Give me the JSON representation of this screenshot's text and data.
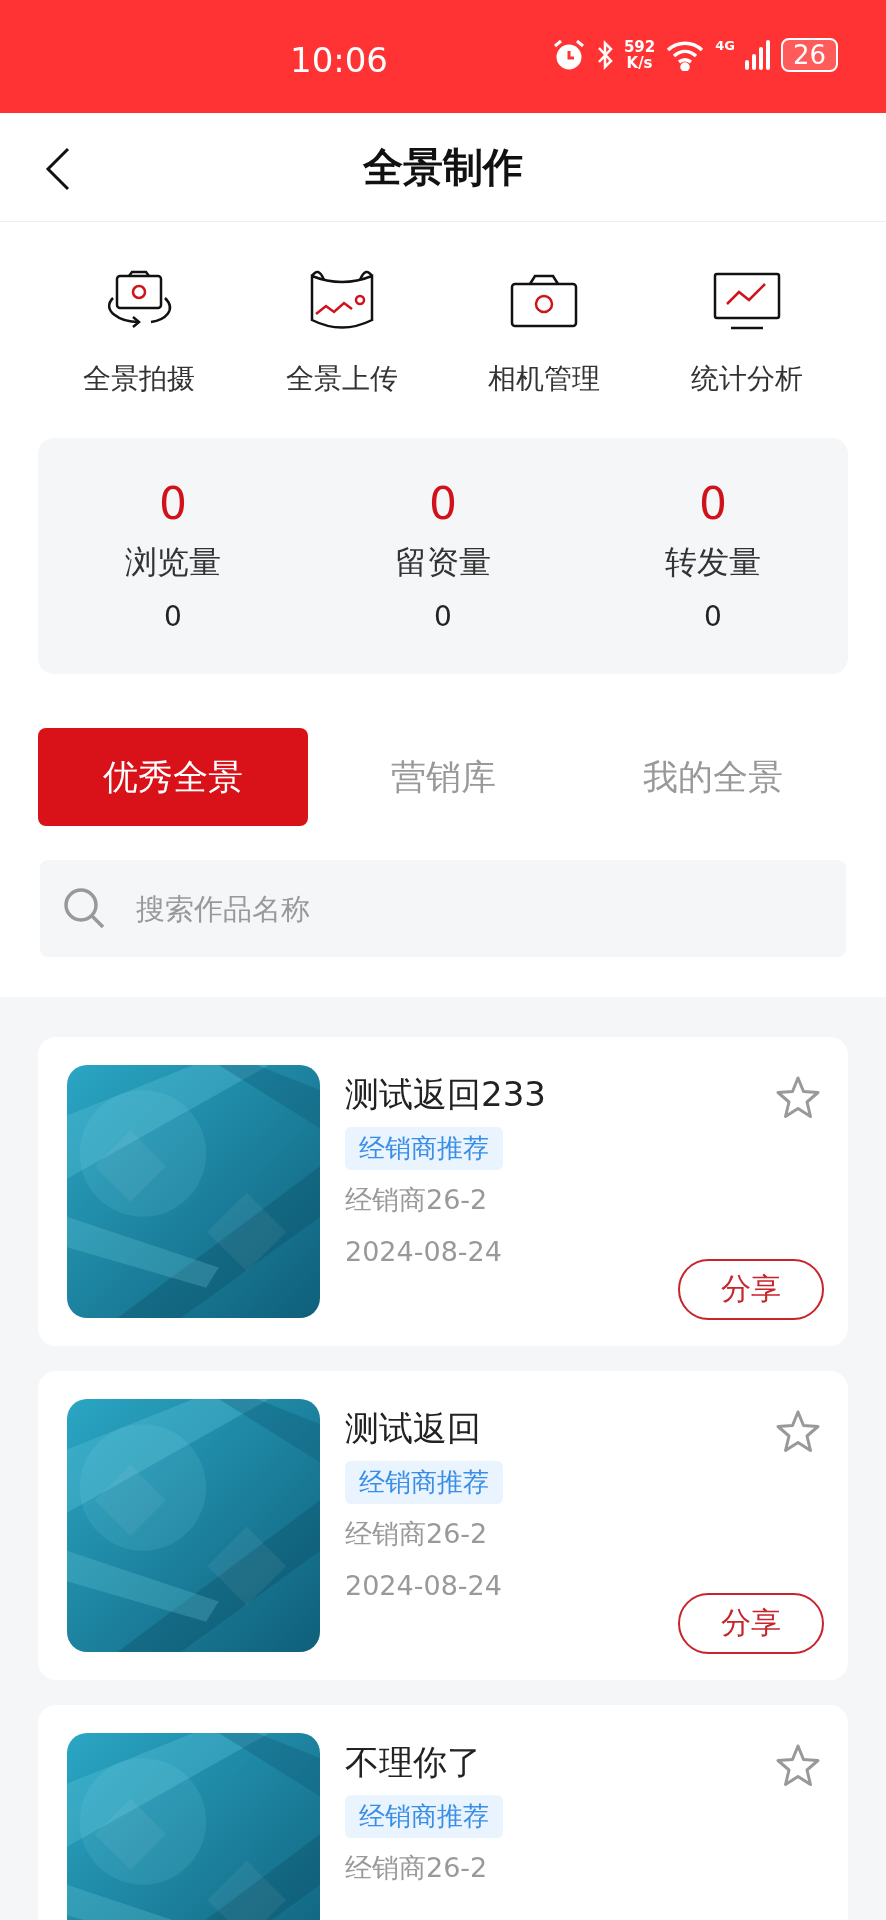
{
  "status_bar": {
    "time": "10:06",
    "speed_value": "592",
    "speed_unit": "K/s",
    "network": "4G",
    "battery": "26"
  },
  "header": {
    "title": "全景制作"
  },
  "actions": [
    {
      "kind": "capture",
      "label": "全景拍摄"
    },
    {
      "kind": "upload",
      "label": "全景上传"
    },
    {
      "kind": "camera",
      "label": "相机管理"
    },
    {
      "kind": "stats",
      "label": "统计分析"
    }
  ],
  "stats": [
    {
      "value": "0",
      "label": "浏览量",
      "sub": "0"
    },
    {
      "value": "0",
      "label": "留资量",
      "sub": "0"
    },
    {
      "value": "0",
      "label": "转发量",
      "sub": "0"
    }
  ],
  "tabs": [
    {
      "label": "优秀全景",
      "selected": true
    },
    {
      "label": "营销库",
      "selected": false
    },
    {
      "label": "我的全景",
      "selected": false
    }
  ],
  "search": {
    "placeholder": "搜索作品名称"
  },
  "items": [
    {
      "title": "测试返回233",
      "tag": "经销商推荐",
      "dealer": "经销商26-2",
      "date": "2024-08-24",
      "starred": false,
      "share": "分享"
    },
    {
      "title": "测试返回",
      "tag": "经销商推荐",
      "dealer": "经销商26-2",
      "date": "2024-08-24",
      "starred": false,
      "share": "分享"
    },
    {
      "title": "不理你了",
      "tag": "经销商推荐",
      "dealer": "经销商26-2",
      "starred": false
    }
  ]
}
